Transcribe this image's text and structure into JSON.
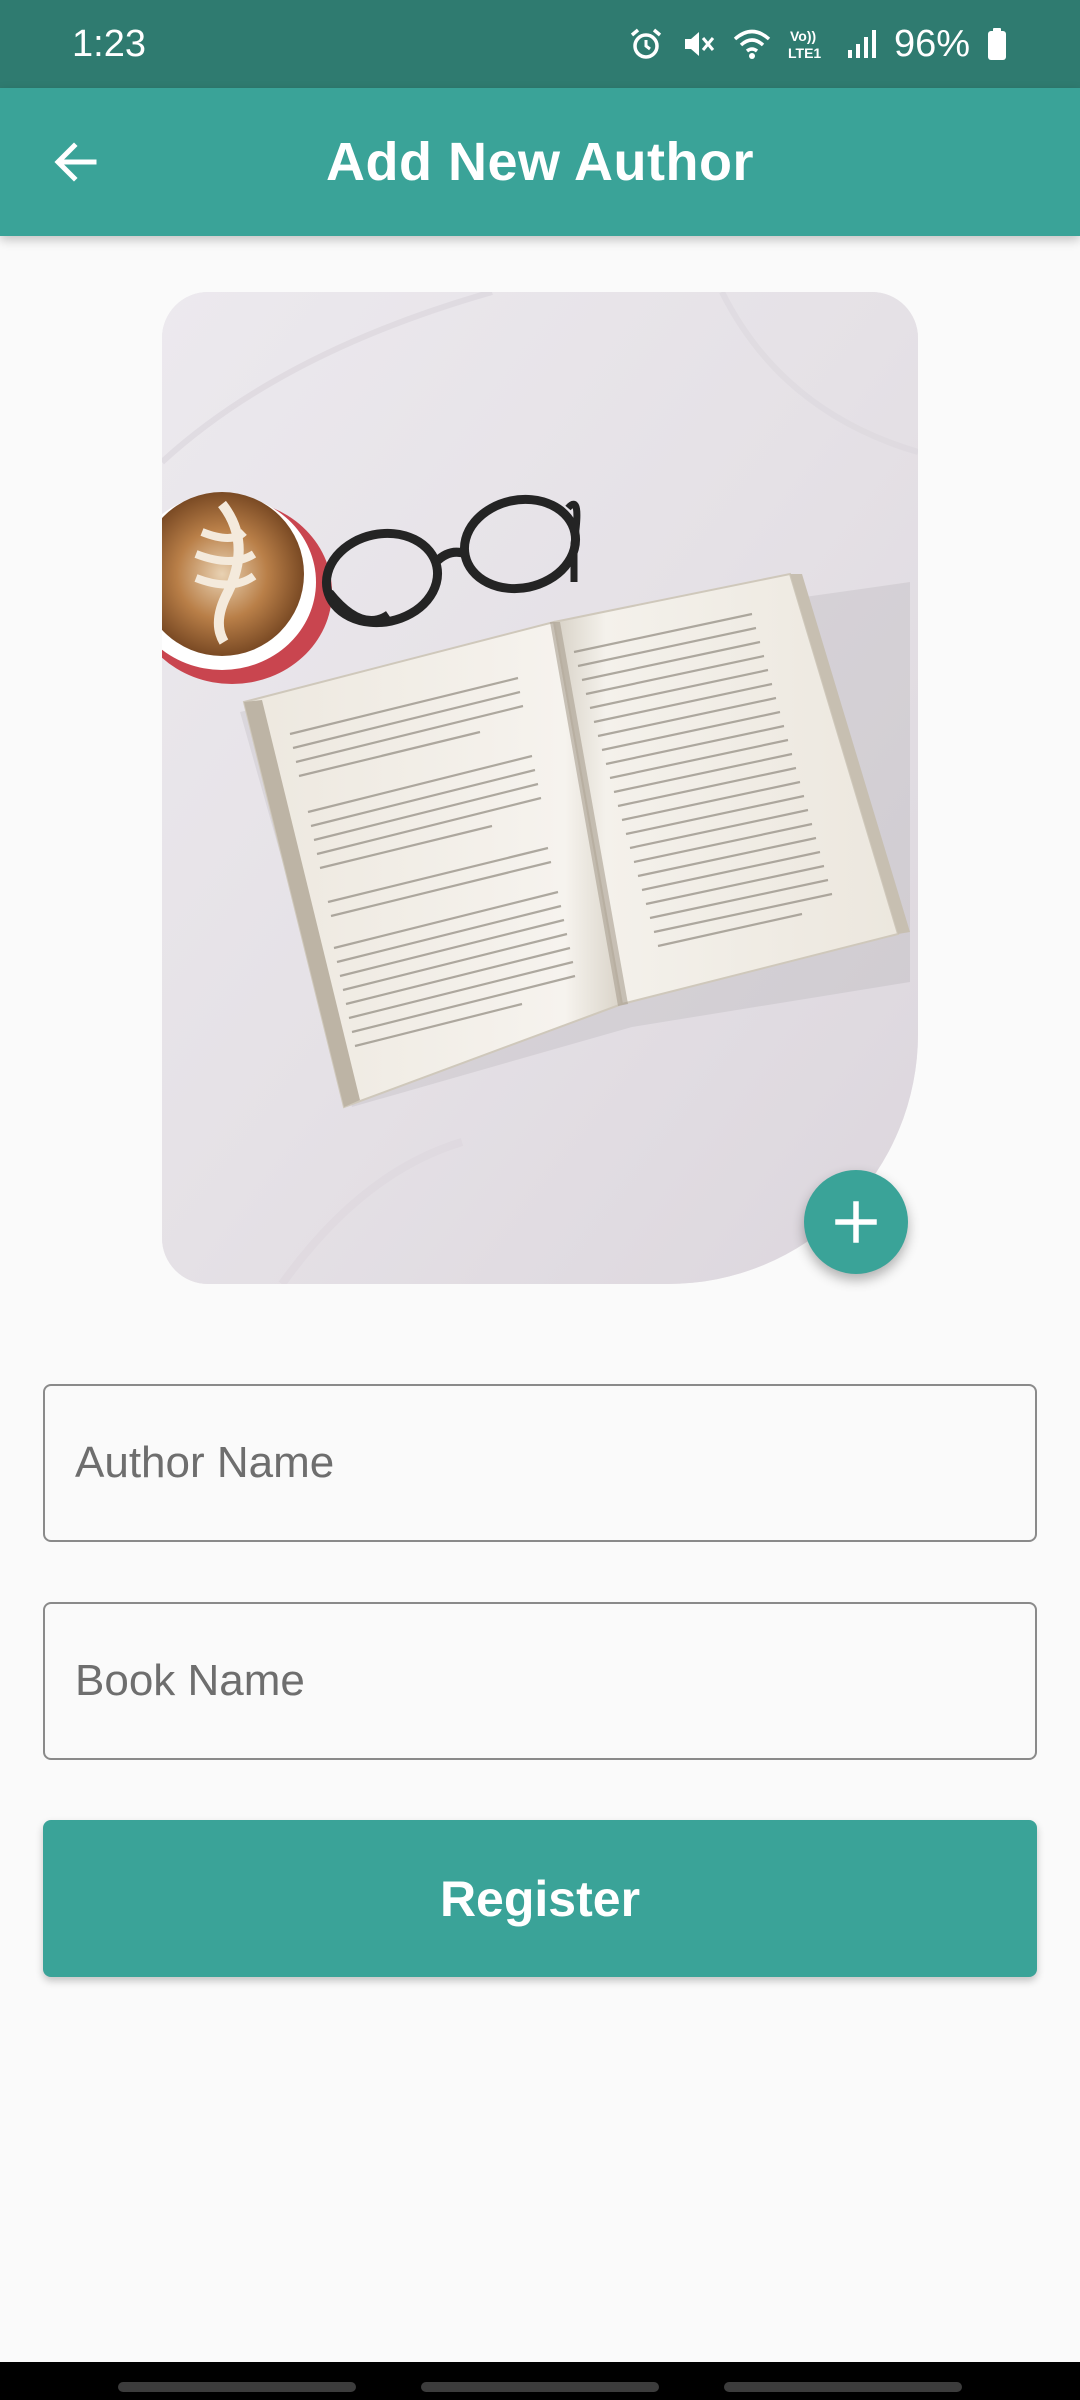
{
  "status_bar": {
    "time": "1:23",
    "battery": "96%",
    "signal_label": "Vo)) LTE1",
    "icons": [
      "alarm-icon",
      "mute-icon",
      "wifi-icon",
      "volte-icon",
      "signal-icon",
      "battery-icon"
    ]
  },
  "app_bar": {
    "title": "Add New Author",
    "back_icon": "arrow-back-icon",
    "color": "#3aa398"
  },
  "image": {
    "description_icon": "book-coffee-glasses-photo",
    "add_button_icon": "plus-icon"
  },
  "form": {
    "author_placeholder": "Author Name",
    "author_value": "",
    "book_placeholder": "Book Name",
    "book_value": "",
    "register_label": "Register"
  },
  "colors": {
    "primary": "#3aa398",
    "status_bar": "#2f7b70",
    "background": "#fafafa"
  }
}
